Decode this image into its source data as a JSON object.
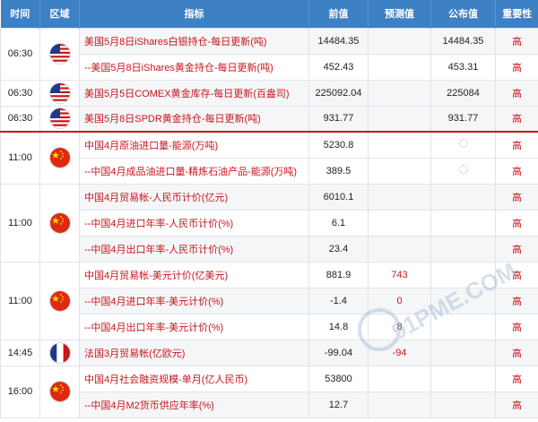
{
  "header": {
    "time": "时间",
    "region": "区域",
    "indicator": "指标",
    "previous": "前值",
    "forecast": "预测值",
    "actual": "公布值",
    "importance": "重要性"
  },
  "rows": [
    {
      "time": "06:30",
      "country": "US",
      "indicator": "美国5月8日iShares白银持仓-每日更新(吨)",
      "previous": "14484.35",
      "forecast": "",
      "actual": "14484.35",
      "importance": "高"
    },
    {
      "time": "",
      "country": "",
      "indicator": "--美国5月8日iShares黄金持仓-每日更新(吨)",
      "previous": "452.43",
      "forecast": "",
      "actual": "453.31",
      "importance": "高"
    },
    {
      "time": "06:30",
      "country": "US",
      "indicator": "美国5月5日COMEX黄金库存-每日更新(百盎司)",
      "previous": "225092.04",
      "forecast": "",
      "actual": "225084",
      "importance": "高"
    },
    {
      "time": "06:30",
      "country": "US",
      "indicator": "美国5月8日SPDR黄金持仓-每日更新(吨)",
      "previous": "931.77",
      "forecast": "",
      "actual": "931.77",
      "importance": "高"
    },
    {
      "time": "11:00",
      "country": "CN",
      "indicator": "中国4月原油进口量-能源(万吨)",
      "previous": "5230.8",
      "forecast": "",
      "actual": "",
      "importance": "高"
    },
    {
      "time": "",
      "country": "",
      "indicator": "--中国4月成品油进口量-精炼石油产品-能源(万吨)",
      "previous": "389.5",
      "forecast": "",
      "actual": "",
      "importance": "高"
    },
    {
      "time": "11:00",
      "country": "CN",
      "indicator": "中国4月贸易帐-人民币计价(亿元)",
      "previous": "6010.1",
      "forecast": "",
      "actual": "",
      "importance": "高"
    },
    {
      "time": "",
      "country": "",
      "indicator": "--中国4月进口年率-人民币计价(%)",
      "previous": "6.1",
      "forecast": "",
      "actual": "",
      "importance": "高"
    },
    {
      "time": "",
      "country": "",
      "indicator": "--中国4月出口年率-人民币计价(%)",
      "previous": "23.4",
      "forecast": "",
      "actual": "",
      "importance": "高"
    },
    {
      "time": "11:00",
      "country": "CN",
      "indicator": "中国4月贸易帐-美元计价(亿美元)",
      "previous": "881.9",
      "forecast": "743",
      "actual": "",
      "importance": "高"
    },
    {
      "time": "",
      "country": "",
      "indicator": "--中国4月进口年率-美元计价(%)",
      "previous": "-1.4",
      "forecast": "0",
      "actual": "",
      "importance": "高"
    },
    {
      "time": "",
      "country": "",
      "indicator": "--中国4月出口年率-美元计价(%)",
      "previous": "14.8",
      "forecast": "8",
      "actual": "",
      "importance": "高"
    },
    {
      "time": "14:45",
      "country": "FR",
      "indicator": "法国3月贸易帐(亿欧元)",
      "previous": "-99.04",
      "forecast": "-94",
      "actual": "",
      "importance": "高"
    },
    {
      "time": "16:00",
      "country": "CN",
      "indicator": "中国4月社会融资规模-单月(亿人民币)",
      "previous": "53800",
      "forecast": "",
      "actual": "",
      "importance": "高"
    },
    {
      "time": "",
      "country": "",
      "indicator": "--中国4月M2货币供应年率(%)",
      "previous": "12.7",
      "forecast": "",
      "actual": "",
      "importance": "高"
    }
  ],
  "watermark": "91PME.COM",
  "colors": {
    "header_bg": "#3d80c4",
    "accent_red": "#c8161d",
    "zebra": "#f5f6f8"
  }
}
